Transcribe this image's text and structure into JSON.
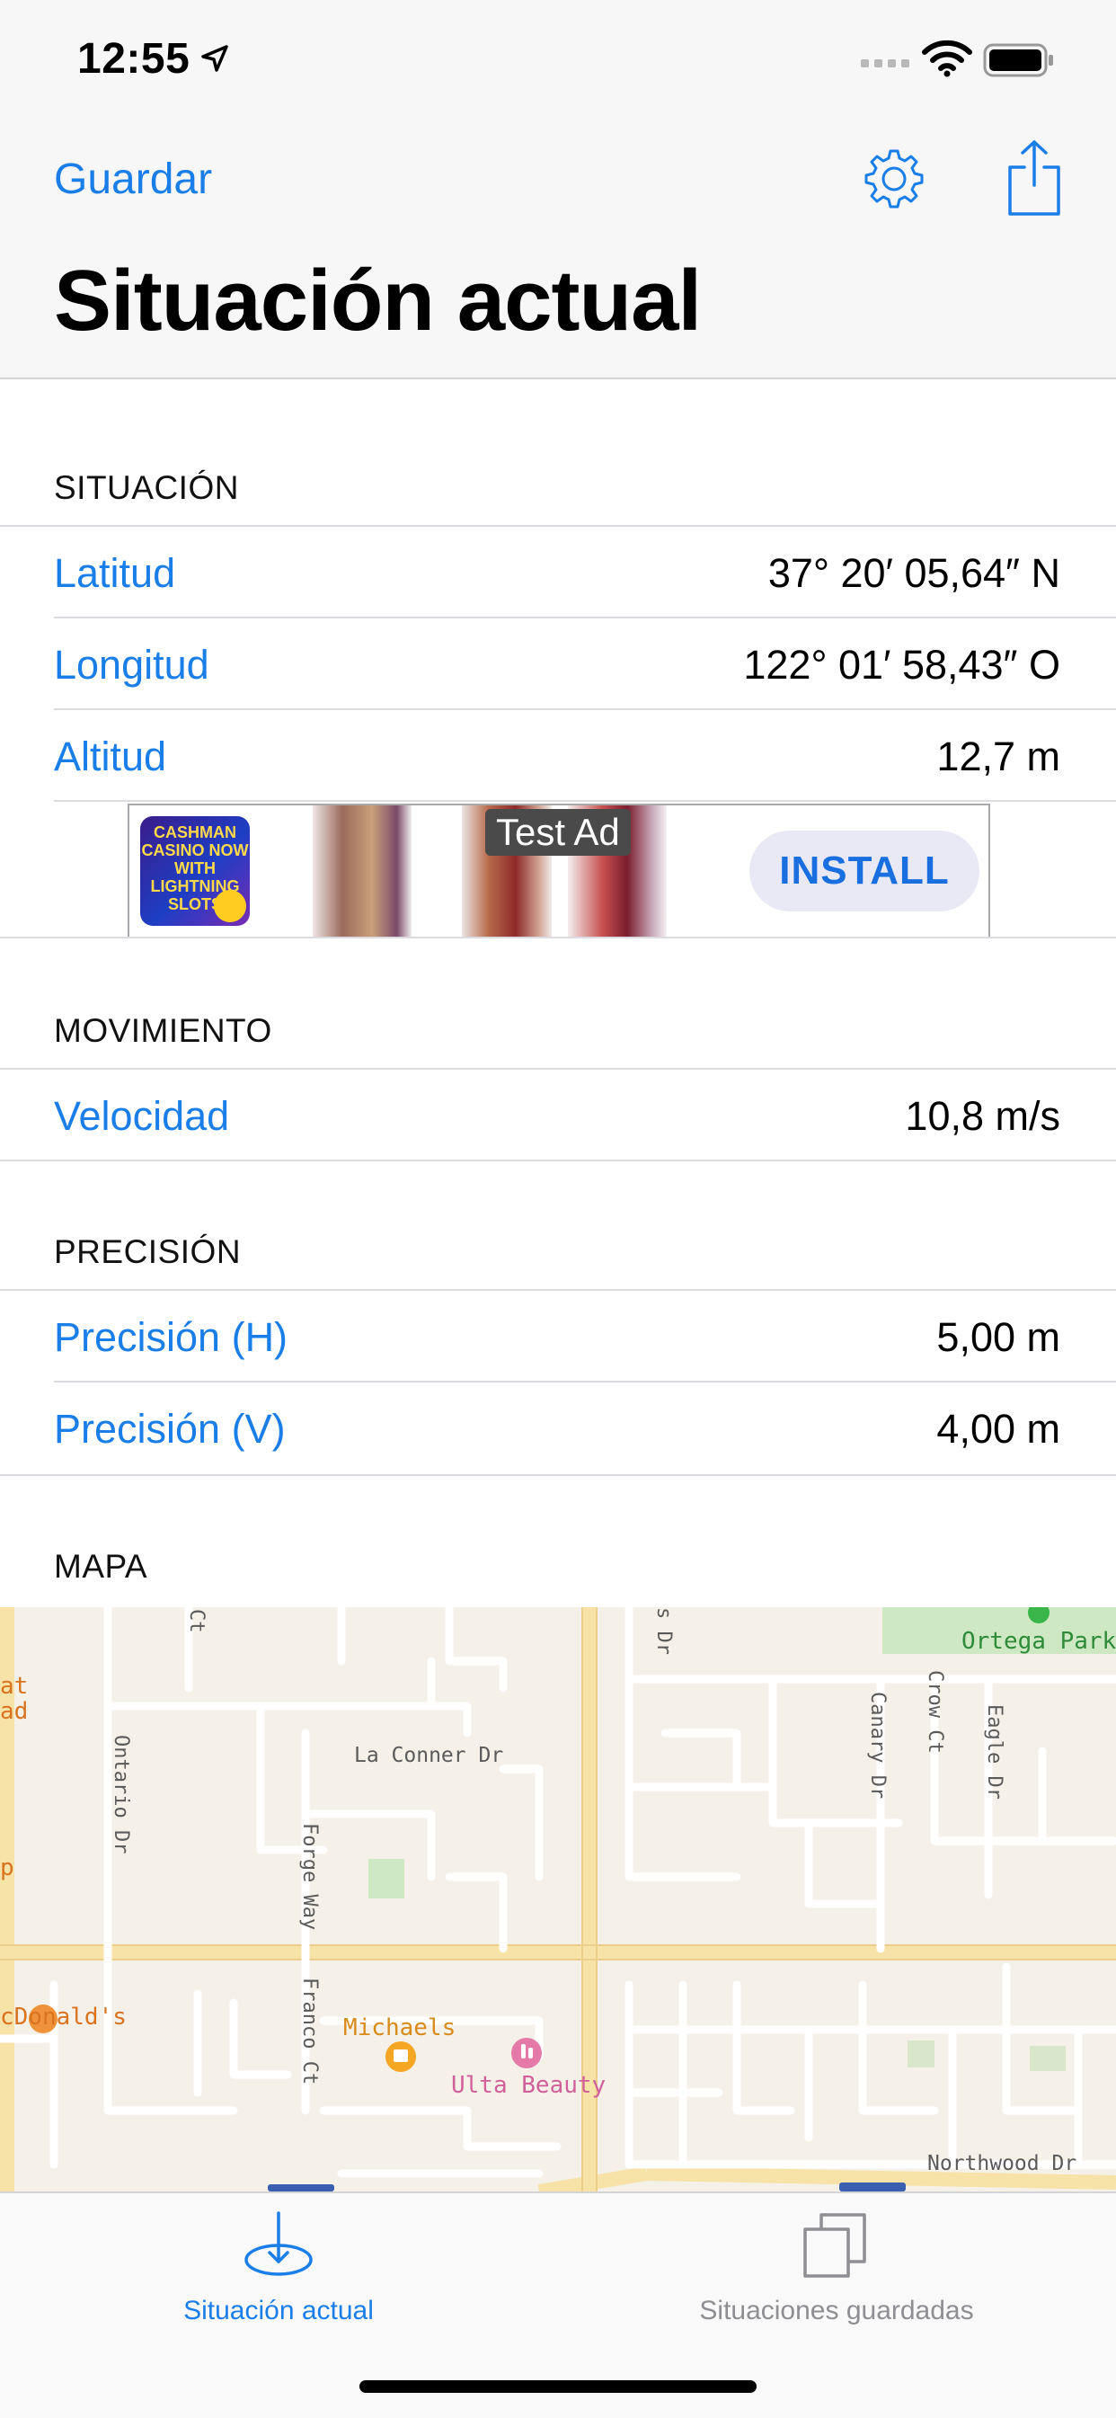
{
  "status_bar": {
    "time": "12:55"
  },
  "nav": {
    "save_label": "Guardar",
    "title": "Situación actual"
  },
  "sections": {
    "situacion": {
      "header": "SITUACIÓN",
      "rows": [
        {
          "label": "Latitud",
          "value": "37° 20′ 05,64″ N"
        },
        {
          "label": "Longitud",
          "value": "122° 01′ 58,43″ O"
        },
        {
          "label": "Altitud",
          "value": "12,7 m"
        }
      ]
    },
    "movimiento": {
      "header": "MOVIMIENTO",
      "rows": [
        {
          "label": "Velocidad",
          "value": "10,8 m/s"
        }
      ]
    },
    "precision": {
      "header": "PRECISIÓN",
      "rows": [
        {
          "label": "Precisión (H)",
          "value": "5,00 m"
        },
        {
          "label": "Precisión (V)",
          "value": "4,00 m"
        }
      ]
    },
    "mapa": {
      "header": "MAPA"
    }
  },
  "ad": {
    "icon_text": "CASHMAN CASINO NOW WITH LIGHTNING SLOTS",
    "test_label": "Test Ad",
    "install_label": "INSTALL"
  },
  "map": {
    "labels": {
      "ortega_park": "Ortega Park",
      "la_conner": "La Conner Dr",
      "ontario": "Ontario Dr",
      "forge_way": "Forge Way",
      "franco_ct": "Franco Ct",
      "canary": "Canary Dr",
      "crow": "Crow Ct",
      "eagle": "Eagle Dr",
      "michaels": "Michaels",
      "ulta": "Ulta Beauty",
      "mcdonalds": "cDonald's",
      "northwood": "Northwood Dr",
      "ct_top": "Ct",
      "s_dr": "s Dr",
      "edge_at": "at",
      "edge_ad": "ad",
      "edge_p": "p"
    }
  },
  "tabs": [
    {
      "label": "Situación actual",
      "active": true
    },
    {
      "label": "Situaciones guardadas",
      "active": false
    }
  ],
  "colors": {
    "accent": "#1a7ee8",
    "inactive": "#8e8e93"
  }
}
